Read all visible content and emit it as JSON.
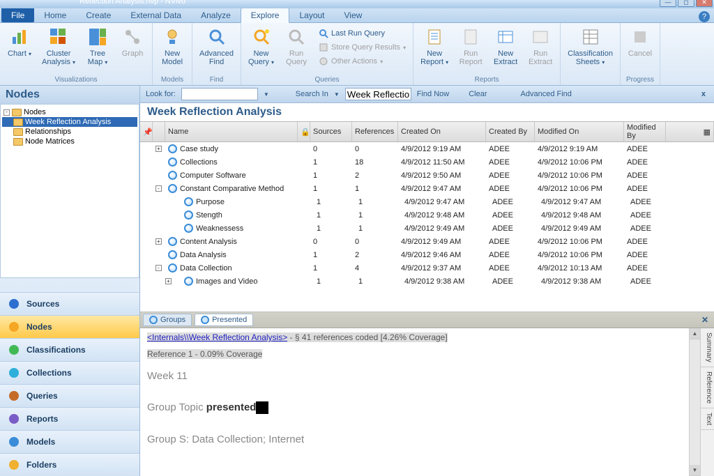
{
  "title": "Reflection Analysis.nvp - NVivo",
  "tabs": {
    "file": "File",
    "list": [
      "Home",
      "Create",
      "External Data",
      "Analyze",
      "Explore",
      "Layout",
      "View"
    ],
    "active": 4
  },
  "ribbon": {
    "groups": [
      {
        "label": "Visualizations",
        "items": [
          {
            "name": "chart",
            "label": "Chart",
            "dd": true
          },
          {
            "name": "cluster",
            "label": "Cluster\nAnalysis",
            "dd": true
          },
          {
            "name": "treemap",
            "label": "Tree\nMap",
            "dd": true
          },
          {
            "name": "graph",
            "label": "Graph",
            "disabled": true
          }
        ]
      },
      {
        "label": "Models",
        "items": [
          {
            "name": "newmodel",
            "label": "New\nModel"
          }
        ]
      },
      {
        "label": "Find",
        "items": [
          {
            "name": "advfind",
            "label": "Advanced\nFind"
          }
        ]
      },
      {
        "label": "Queries",
        "items": [
          {
            "name": "newquery",
            "label": "New\nQuery",
            "dd": true
          },
          {
            "name": "runquery",
            "label": "Run\nQuery",
            "disabled": true
          }
        ],
        "small": [
          {
            "name": "lastrun",
            "label": "Last Run Query"
          },
          {
            "name": "storeres",
            "label": "Store Query Results",
            "dd": true,
            "disabled": true
          },
          {
            "name": "otheract",
            "label": "Other Actions",
            "dd": true,
            "disabled": true
          }
        ]
      },
      {
        "label": "Reports",
        "items": [
          {
            "name": "newreport",
            "label": "New\nReport",
            "dd": true
          },
          {
            "name": "runreport",
            "label": "Run\nReport",
            "disabled": true
          },
          {
            "name": "newextract",
            "label": "New\nExtract"
          },
          {
            "name": "runextract",
            "label": "Run\nExtract",
            "disabled": true
          }
        ]
      },
      {
        "label": "",
        "items": [
          {
            "name": "classsheets",
            "label": "Classification\nSheets",
            "dd": true
          }
        ]
      },
      {
        "label": "Progress",
        "items": [
          {
            "name": "cancel",
            "label": "Cancel",
            "disabled": true
          }
        ]
      }
    ]
  },
  "left": {
    "title": "Nodes",
    "tree": [
      {
        "label": "Nodes",
        "exp": "-",
        "depth": 0,
        "sel": false
      },
      {
        "label": "Week Reflection Analysis",
        "depth": 1,
        "sel": true
      },
      {
        "label": "Relationships",
        "depth": 0,
        "sel": false
      },
      {
        "label": "Node Matrices",
        "depth": 0,
        "sel": false
      }
    ],
    "panes": [
      {
        "name": "sources",
        "label": "Sources",
        "color": "#2d6fd1"
      },
      {
        "name": "nodes",
        "label": "Nodes",
        "color": "#f5a623",
        "active": true
      },
      {
        "name": "classifications",
        "label": "Classifications",
        "color": "#43b956"
      },
      {
        "name": "collections",
        "label": "Collections",
        "color": "#2daedb"
      },
      {
        "name": "queries",
        "label": "Queries",
        "color": "#c46b2a"
      },
      {
        "name": "reports",
        "label": "Reports",
        "color": "#7a5cc7"
      },
      {
        "name": "models",
        "label": "Models",
        "color": "#3a8cd8"
      },
      {
        "name": "folders",
        "label": "Folders",
        "color": "#f0b030"
      }
    ]
  },
  "findbar": {
    "lookfor": "Look for:",
    "searchin": "Search In",
    "scope": "Week Reflection",
    "findnow": "Find Now",
    "clear": "Clear",
    "advanced": "Advanced Find"
  },
  "grid": {
    "title": "Week Reflection Analysis",
    "headers": {
      "name": "Name",
      "sources": "Sources",
      "refs": "References",
      "created": "Created On",
      "cby": "Created By",
      "mod": "Modified On",
      "mby": "Modified By"
    },
    "rows": [
      {
        "exp": "+",
        "depth": 0,
        "name": "Case study",
        "src": "0",
        "ref": "0",
        "c": "4/9/2012 9:19 AM",
        "cb": "ADEE",
        "m": "4/9/2012 9:19 AM",
        "mb": "ADEE"
      },
      {
        "exp": "",
        "depth": 0,
        "name": "Collections",
        "src": "1",
        "ref": "18",
        "c": "4/9/2012 11:50 AM",
        "cb": "ADEE",
        "m": "4/9/2012 10:06 PM",
        "mb": "ADEE"
      },
      {
        "exp": "",
        "depth": 0,
        "name": "Computer Software",
        "src": "1",
        "ref": "2",
        "c": "4/9/2012 9:50 AM",
        "cb": "ADEE",
        "m": "4/9/2012 10:06 PM",
        "mb": "ADEE"
      },
      {
        "exp": "-",
        "depth": 0,
        "name": "Constant Comparative Method",
        "src": "1",
        "ref": "1",
        "c": "4/9/2012 9:47 AM",
        "cb": "ADEE",
        "m": "4/9/2012 10:06 PM",
        "mb": "ADEE"
      },
      {
        "exp": "",
        "depth": 1,
        "name": "Purpose",
        "src": "1",
        "ref": "1",
        "c": "4/9/2012 9:47 AM",
        "cb": "ADEE",
        "m": "4/9/2012 9:47 AM",
        "mb": "ADEE"
      },
      {
        "exp": "",
        "depth": 1,
        "name": "Stength",
        "src": "1",
        "ref": "1",
        "c": "4/9/2012 9:48 AM",
        "cb": "ADEE",
        "m": "4/9/2012 9:48 AM",
        "mb": "ADEE"
      },
      {
        "exp": "",
        "depth": 1,
        "name": "Weaknessess",
        "src": "1",
        "ref": "1",
        "c": "4/9/2012 9:49 AM",
        "cb": "ADEE",
        "m": "4/9/2012 9:49 AM",
        "mb": "ADEE"
      },
      {
        "exp": "+",
        "depth": 0,
        "name": "Content Analysis",
        "src": "0",
        "ref": "0",
        "c": "4/9/2012 9:49 AM",
        "cb": "ADEE",
        "m": "4/9/2012 10:06 PM",
        "mb": "ADEE"
      },
      {
        "exp": "",
        "depth": 0,
        "name": "Data Analysis",
        "src": "1",
        "ref": "2",
        "c": "4/9/2012 9:46 AM",
        "cb": "ADEE",
        "m": "4/9/2012 10:06 PM",
        "mb": "ADEE"
      },
      {
        "exp": "-",
        "depth": 0,
        "name": "Data Collection",
        "src": "1",
        "ref": "4",
        "c": "4/9/2012 9:37 AM",
        "cb": "ADEE",
        "m": "4/9/2012 10:13 AM",
        "mb": "ADEE"
      },
      {
        "exp": "+",
        "depth": 1,
        "name": "Images and Video",
        "src": "1",
        "ref": "1",
        "c": "4/9/2012 9:38 AM",
        "cb": "ADEE",
        "m": "4/9/2012 9:38 AM",
        "mb": "ADEE"
      }
    ]
  },
  "detail": {
    "tabs": [
      {
        "label": "Groups"
      },
      {
        "label": "Presented",
        "active": true
      }
    ],
    "link": "<Internals\\\\Week Reflection Analysis>",
    "linksuffix": " - § 41 references coded  [4.26% Coverage]",
    "ref1": "Reference 1 - 0.09% Coverage",
    "week": "Week 11",
    "topic_pre": "Group Topic ",
    "topic_bold": "presented",
    "groups": "Group S: Data Collection; Internet",
    "sidetabs": [
      "Summary",
      "Reference",
      "Text"
    ]
  }
}
